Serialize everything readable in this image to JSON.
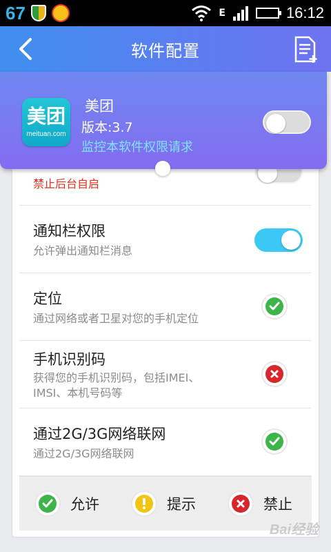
{
  "status_bar": {
    "notification_count": "67",
    "signal_letter": "E",
    "time": "16:12"
  },
  "app_bar": {
    "title": "软件配置"
  },
  "app_info": {
    "icon_text": "美团",
    "icon_subtext": "meituan.com",
    "name": "美团",
    "version": "版本:3.7",
    "monitor_label": "监控本软件权限请求",
    "monitor_enabled": false
  },
  "permissions": [
    {
      "title": "",
      "subtitle": "禁止后台自启",
      "control": "toggle",
      "enabled": false
    },
    {
      "title": "通知栏权限",
      "subtitle": "允许弹出通知栏消息",
      "control": "toggle",
      "enabled": true
    },
    {
      "title": "定位",
      "subtitle": "通过网络或者卫星对您的手机定位",
      "control": "status",
      "status": "allow"
    },
    {
      "title": "手机识别码",
      "subtitle": "获得您的手机识别码，包括IMEI、IMSI、本机号码等",
      "control": "status",
      "status": "deny"
    },
    {
      "title": "通过2G/3G网络联网",
      "subtitle": "通过2G/3G网络联网",
      "control": "status",
      "status": "allow"
    }
  ],
  "legend": {
    "allow": "允许",
    "prompt": "提示",
    "deny": "禁止"
  },
  "watermark": "Bai经验",
  "colors": {
    "allow": "#3cb549",
    "prompt": "#f2c513",
    "deny": "#d9262b",
    "toggle_on": "#3cc8f4",
    "warning_text": "#e0301e"
  }
}
